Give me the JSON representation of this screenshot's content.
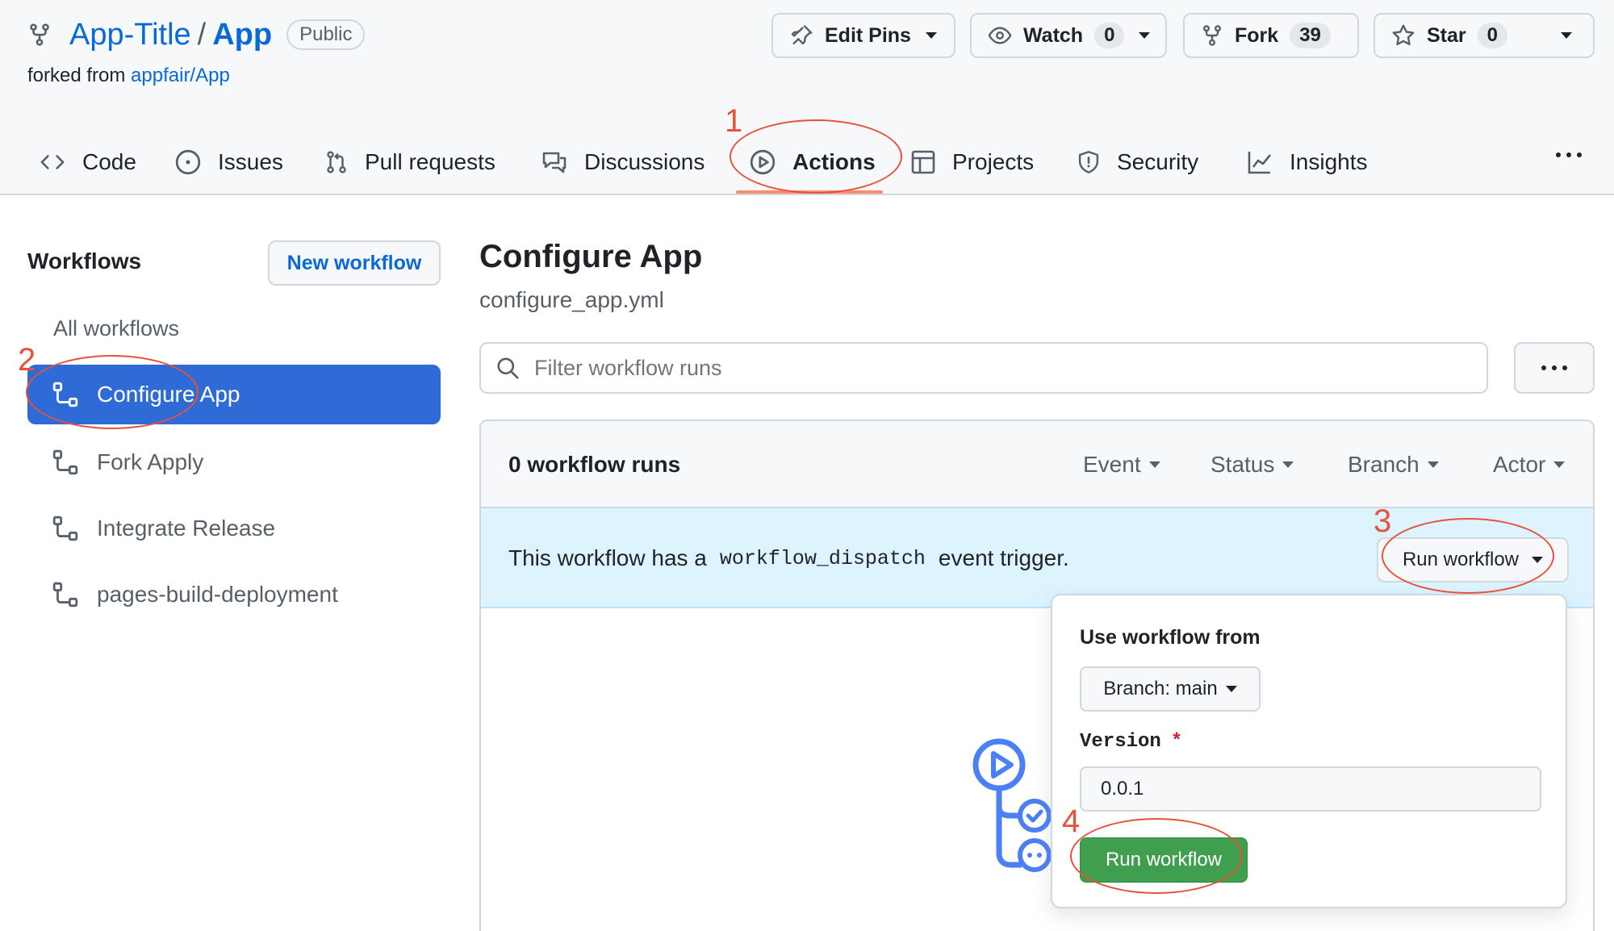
{
  "repo": {
    "owner": "App-Title",
    "slash": "/",
    "name": "App",
    "visibility": "Public",
    "forked_prefix": "forked from",
    "forked_source": "appfair/App"
  },
  "header_buttons": {
    "edit_pins": "Edit Pins",
    "watch": "Watch",
    "watch_count": "0",
    "fork": "Fork",
    "fork_count": "39",
    "star": "Star",
    "star_count": "0"
  },
  "tabs": [
    {
      "label": "Code",
      "icon": "code-icon"
    },
    {
      "label": "Issues",
      "icon": "issue-icon"
    },
    {
      "label": "Pull requests",
      "icon": "pull-request-icon"
    },
    {
      "label": "Discussions",
      "icon": "discussions-icon"
    },
    {
      "label": "Actions",
      "icon": "play-icon",
      "selected": true
    },
    {
      "label": "Projects",
      "icon": "table-icon"
    },
    {
      "label": "Security",
      "icon": "shield-icon"
    },
    {
      "label": "Insights",
      "icon": "graph-icon"
    }
  ],
  "sidebar": {
    "title": "Workflows",
    "new_workflow": "New workflow",
    "all_workflows": "All workflows",
    "workflows": [
      "Configure App",
      "Fork Apply",
      "Integrate Release",
      "pages-build-deployment"
    ],
    "active_index": 0
  },
  "main": {
    "title": "Configure App",
    "file": "configure_app.yml",
    "filter_placeholder": "Filter workflow runs",
    "runs_count": "0 workflow runs",
    "filters": [
      "Event",
      "Status",
      "Branch",
      "Actor"
    ],
    "dispatch_prefix": "This workflow has a",
    "dispatch_code": "workflow_dispatch",
    "dispatch_suffix": "event trigger.",
    "run_workflow": "Run workflow"
  },
  "dropdown": {
    "title": "Use workflow from",
    "branch": "Branch: main",
    "version_label": "Version",
    "required_mark": "*",
    "version_value": "0.0.1",
    "submit": "Run workflow"
  },
  "annotations": [
    "1",
    "2",
    "3",
    "4"
  ],
  "colors": {
    "accent_blue": "#0969da",
    "active_item": "#2f6bd6",
    "annotation": "#e8513b",
    "run_button_green": "#3f9f4f",
    "banner": "#ddf4ff",
    "tab_underline": "#fd8c73"
  }
}
